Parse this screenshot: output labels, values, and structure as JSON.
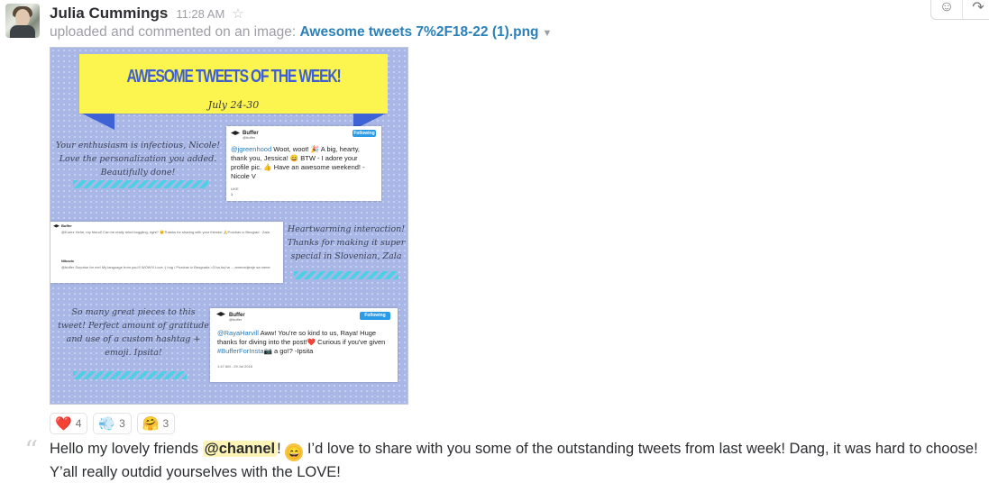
{
  "author": {
    "name": "Julia Cummings",
    "time": "11:28 AM"
  },
  "subline": {
    "prefix": "uploaded and commented on an image:",
    "filename": "Awesome tweets 7%2F18-22 (1).png"
  },
  "image": {
    "banner_title": "AWESOME TWEETS OF THE WEEK!",
    "banner_date": "July 24-30",
    "quote1": "Your enthusiasm is infectious, Nicole! Love the personalization you added. Beautifully done!",
    "quote2": "Heartwarming interaction! Thanks for making it super special in Slovenian, Zala",
    "quote3": "So many great pieces to this tweet! Perfect amount of gratitude and use of a custom hashtag + emoji. Ipsita!",
    "tweet1": {
      "name": "Buffer",
      "handle": "@buffer",
      "follow": "Following",
      "mention": "@jgreenhood",
      "text": " Woot, woot! 🎉 A big, hearty, thank you, Jessica! 😄 BTW - I adore your profile pic. 👍 Have an awesome weekend! -Nicole V",
      "likes_label": "LIKE",
      "likes": "1"
    },
    "tweet2": {
      "name": "Buffer",
      "line1": "@Kurez Hehe, my friend! Can be really mind boggling, right? 😊Thanks for sharing with your friends! 🙏Pozdrav iz Beograd · Zala",
      "reply_name": "Nikovic",
      "line2": "@buffer Surprise for me! My language from you!!! WOW!!! Love :) hug / Pozdrav iz Beograda <3 ha,ha,ha ... ameravljenje sa mene"
    },
    "tweet3": {
      "name": "Buffer",
      "handle": "@buffer",
      "follow": "Following",
      "mention": "@RayaHarvill",
      "text": " Aww! You're so kind to us, Raya! Huge thanks for diving into the post!❤️ Curious if you've given ",
      "hashtag": "#BufferForInsta",
      "text2": "📷 a go!? -Ipsita",
      "meta": "1:47 AM - 29 Jul 2016"
    }
  },
  "reactions": [
    {
      "icon": "heart-icon",
      "glyph": "❤️",
      "count": "4"
    },
    {
      "icon": "dash-icon",
      "glyph": "💨",
      "count": "3"
    },
    {
      "icon": "hugging-face-icon",
      "glyph": "🤗",
      "count": "3"
    }
  ],
  "message": {
    "part1": "Hello my lovely friends ",
    "channel": "@channel",
    "part2": "! ",
    "emoji": "😄",
    "part3": " I’d love to share with you some of the outstanding tweets from last week! Dang, it was hard to choose! Y’all really outdid yourselves with the LOVE!"
  }
}
